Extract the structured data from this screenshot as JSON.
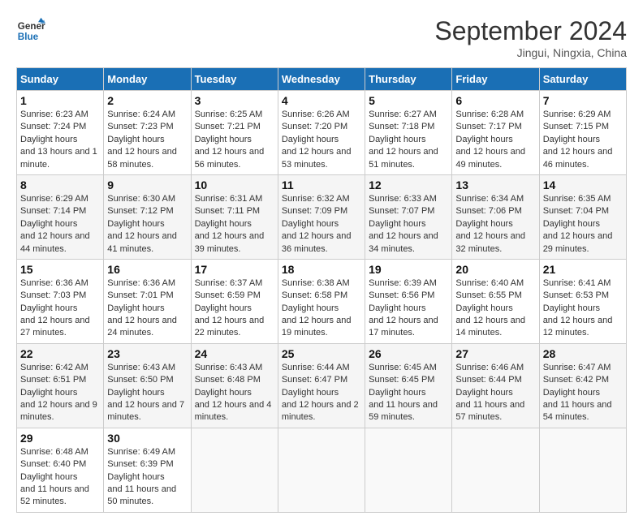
{
  "logo": {
    "line1": "General",
    "line2": "Blue"
  },
  "title": "September 2024",
  "subtitle": "Jingui, Ningxia, China",
  "days_of_week": [
    "Sunday",
    "Monday",
    "Tuesday",
    "Wednesday",
    "Thursday",
    "Friday",
    "Saturday"
  ],
  "weeks": [
    [
      {
        "num": "1",
        "sunrise": "6:23 AM",
        "sunset": "7:24 PM",
        "daylight": "13 hours and 1 minute."
      },
      {
        "num": "2",
        "sunrise": "6:24 AM",
        "sunset": "7:23 PM",
        "daylight": "12 hours and 58 minutes."
      },
      {
        "num": "3",
        "sunrise": "6:25 AM",
        "sunset": "7:21 PM",
        "daylight": "12 hours and 56 minutes."
      },
      {
        "num": "4",
        "sunrise": "6:26 AM",
        "sunset": "7:20 PM",
        "daylight": "12 hours and 53 minutes."
      },
      {
        "num": "5",
        "sunrise": "6:27 AM",
        "sunset": "7:18 PM",
        "daylight": "12 hours and 51 minutes."
      },
      {
        "num": "6",
        "sunrise": "6:28 AM",
        "sunset": "7:17 PM",
        "daylight": "12 hours and 49 minutes."
      },
      {
        "num": "7",
        "sunrise": "6:29 AM",
        "sunset": "7:15 PM",
        "daylight": "12 hours and 46 minutes."
      }
    ],
    [
      {
        "num": "8",
        "sunrise": "6:29 AM",
        "sunset": "7:14 PM",
        "daylight": "12 hours and 44 minutes."
      },
      {
        "num": "9",
        "sunrise": "6:30 AM",
        "sunset": "7:12 PM",
        "daylight": "12 hours and 41 minutes."
      },
      {
        "num": "10",
        "sunrise": "6:31 AM",
        "sunset": "7:11 PM",
        "daylight": "12 hours and 39 minutes."
      },
      {
        "num": "11",
        "sunrise": "6:32 AM",
        "sunset": "7:09 PM",
        "daylight": "12 hours and 36 minutes."
      },
      {
        "num": "12",
        "sunrise": "6:33 AM",
        "sunset": "7:07 PM",
        "daylight": "12 hours and 34 minutes."
      },
      {
        "num": "13",
        "sunrise": "6:34 AM",
        "sunset": "7:06 PM",
        "daylight": "12 hours and 32 minutes."
      },
      {
        "num": "14",
        "sunrise": "6:35 AM",
        "sunset": "7:04 PM",
        "daylight": "12 hours and 29 minutes."
      }
    ],
    [
      {
        "num": "15",
        "sunrise": "6:36 AM",
        "sunset": "7:03 PM",
        "daylight": "12 hours and 27 minutes."
      },
      {
        "num": "16",
        "sunrise": "6:36 AM",
        "sunset": "7:01 PM",
        "daylight": "12 hours and 24 minutes."
      },
      {
        "num": "17",
        "sunrise": "6:37 AM",
        "sunset": "6:59 PM",
        "daylight": "12 hours and 22 minutes."
      },
      {
        "num": "18",
        "sunrise": "6:38 AM",
        "sunset": "6:58 PM",
        "daylight": "12 hours and 19 minutes."
      },
      {
        "num": "19",
        "sunrise": "6:39 AM",
        "sunset": "6:56 PM",
        "daylight": "12 hours and 17 minutes."
      },
      {
        "num": "20",
        "sunrise": "6:40 AM",
        "sunset": "6:55 PM",
        "daylight": "12 hours and 14 minutes."
      },
      {
        "num": "21",
        "sunrise": "6:41 AM",
        "sunset": "6:53 PM",
        "daylight": "12 hours and 12 minutes."
      }
    ],
    [
      {
        "num": "22",
        "sunrise": "6:42 AM",
        "sunset": "6:51 PM",
        "daylight": "12 hours and 9 minutes."
      },
      {
        "num": "23",
        "sunrise": "6:43 AM",
        "sunset": "6:50 PM",
        "daylight": "12 hours and 7 minutes."
      },
      {
        "num": "24",
        "sunrise": "6:43 AM",
        "sunset": "6:48 PM",
        "daylight": "12 hours and 4 minutes."
      },
      {
        "num": "25",
        "sunrise": "6:44 AM",
        "sunset": "6:47 PM",
        "daylight": "12 hours and 2 minutes."
      },
      {
        "num": "26",
        "sunrise": "6:45 AM",
        "sunset": "6:45 PM",
        "daylight": "11 hours and 59 minutes."
      },
      {
        "num": "27",
        "sunrise": "6:46 AM",
        "sunset": "6:44 PM",
        "daylight": "11 hours and 57 minutes."
      },
      {
        "num": "28",
        "sunrise": "6:47 AM",
        "sunset": "6:42 PM",
        "daylight": "11 hours and 54 minutes."
      }
    ],
    [
      {
        "num": "29",
        "sunrise": "6:48 AM",
        "sunset": "6:40 PM",
        "daylight": "11 hours and 52 minutes."
      },
      {
        "num": "30",
        "sunrise": "6:49 AM",
        "sunset": "6:39 PM",
        "daylight": "11 hours and 50 minutes."
      },
      null,
      null,
      null,
      null,
      null
    ]
  ]
}
